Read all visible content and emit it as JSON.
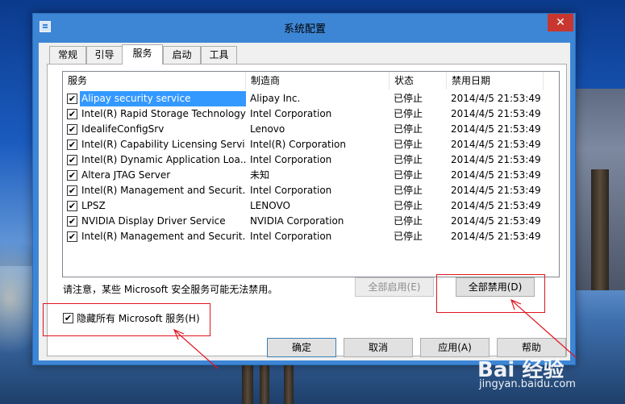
{
  "window": {
    "title": "系统配置",
    "close_label": "✕"
  },
  "tabs": [
    {
      "label": "常规",
      "active": false
    },
    {
      "label": "引导",
      "active": false
    },
    {
      "label": "服务",
      "active": true
    },
    {
      "label": "启动",
      "active": false
    },
    {
      "label": "工具",
      "active": false
    }
  ],
  "services": {
    "columns": {
      "name": "服务",
      "manufacturer": "制造商",
      "status": "状态",
      "disabled_date": "禁用日期"
    },
    "rows": [
      {
        "checked": "✔",
        "name": "Alipay security service",
        "manufacturer": "Alipay Inc.",
        "status": "已停止",
        "date": "2014/4/5 21:53:49"
      },
      {
        "checked": "✔",
        "name": "Intel(R) Rapid Storage Technology",
        "manufacturer": "Intel Corporation",
        "status": "已停止",
        "date": "2014/4/5 21:53:49"
      },
      {
        "checked": "✔",
        "name": "IdealifeConfigSrv",
        "manufacturer": "Lenovo",
        "status": "已停止",
        "date": "2014/4/5 21:53:49"
      },
      {
        "checked": "✔",
        "name": "Intel(R) Capability Licensing Servi...",
        "manufacturer": "Intel(R) Corporation",
        "status": "已停止",
        "date": "2014/4/5 21:53:49"
      },
      {
        "checked": "✔",
        "name": "Intel(R) Dynamic Application Loa...",
        "manufacturer": "Intel Corporation",
        "status": "已停止",
        "date": "2014/4/5 21:53:49"
      },
      {
        "checked": "✔",
        "name": "Altera JTAG Server",
        "manufacturer": "未知",
        "status": "已停止",
        "date": "2014/4/5 21:53:49"
      },
      {
        "checked": "✔",
        "name": "Intel(R) Management and Securit...",
        "manufacturer": "Intel Corporation",
        "status": "已停止",
        "date": "2014/4/5 21:53:49"
      },
      {
        "checked": "✔",
        "name": "LPSZ",
        "manufacturer": "LENOVO",
        "status": "已停止",
        "date": "2014/4/5 21:53:49"
      },
      {
        "checked": "✔",
        "name": "NVIDIA Display Driver Service",
        "manufacturer": "NVIDIA Corporation",
        "status": "已停止",
        "date": "2014/4/5 21:53:49"
      },
      {
        "checked": "✔",
        "name": "Intel(R) Management and Securit...",
        "manufacturer": "Intel Corporation",
        "status": "已停止",
        "date": "2014/4/5 21:53:49"
      }
    ]
  },
  "note": "请注意，某些 Microsoft 安全服务可能无法禁用。",
  "buttons": {
    "enable_all": "全部启用(E)",
    "disable_all": "全部禁用(D)",
    "ok": "确定",
    "cancel": "取消",
    "apply": "应用(A)",
    "help": "帮助"
  },
  "hide_microsoft": {
    "checked": "✔",
    "label": "隐藏所有 Microsoft 服务(H)"
  },
  "watermark": {
    "logo": "Bai  经验",
    "url": "jingyan.baidu.com"
  },
  "colors": {
    "selection": "#3399ff",
    "annotation": "#e0141e",
    "titlebar": "#3d86d6",
    "close": "#c7372f"
  }
}
